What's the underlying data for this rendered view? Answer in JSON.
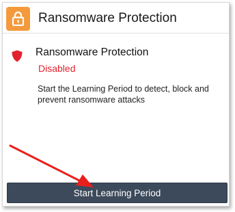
{
  "header": {
    "title": "Ransomware Protection",
    "icon": "padlock-icon",
    "accent_color": "#f49a3c"
  },
  "panel": {
    "icon": "shield-icon",
    "title": "Ransomware Protection",
    "status": "Disabled",
    "status_color": "#e2222e",
    "description": "Start the Learning Period to detect, block and prevent ransomware attacks"
  },
  "actions": {
    "start_label": "Start Learning Period"
  },
  "annotation": {
    "icon": "red-arrow-annotation",
    "color": "#e8201c"
  }
}
